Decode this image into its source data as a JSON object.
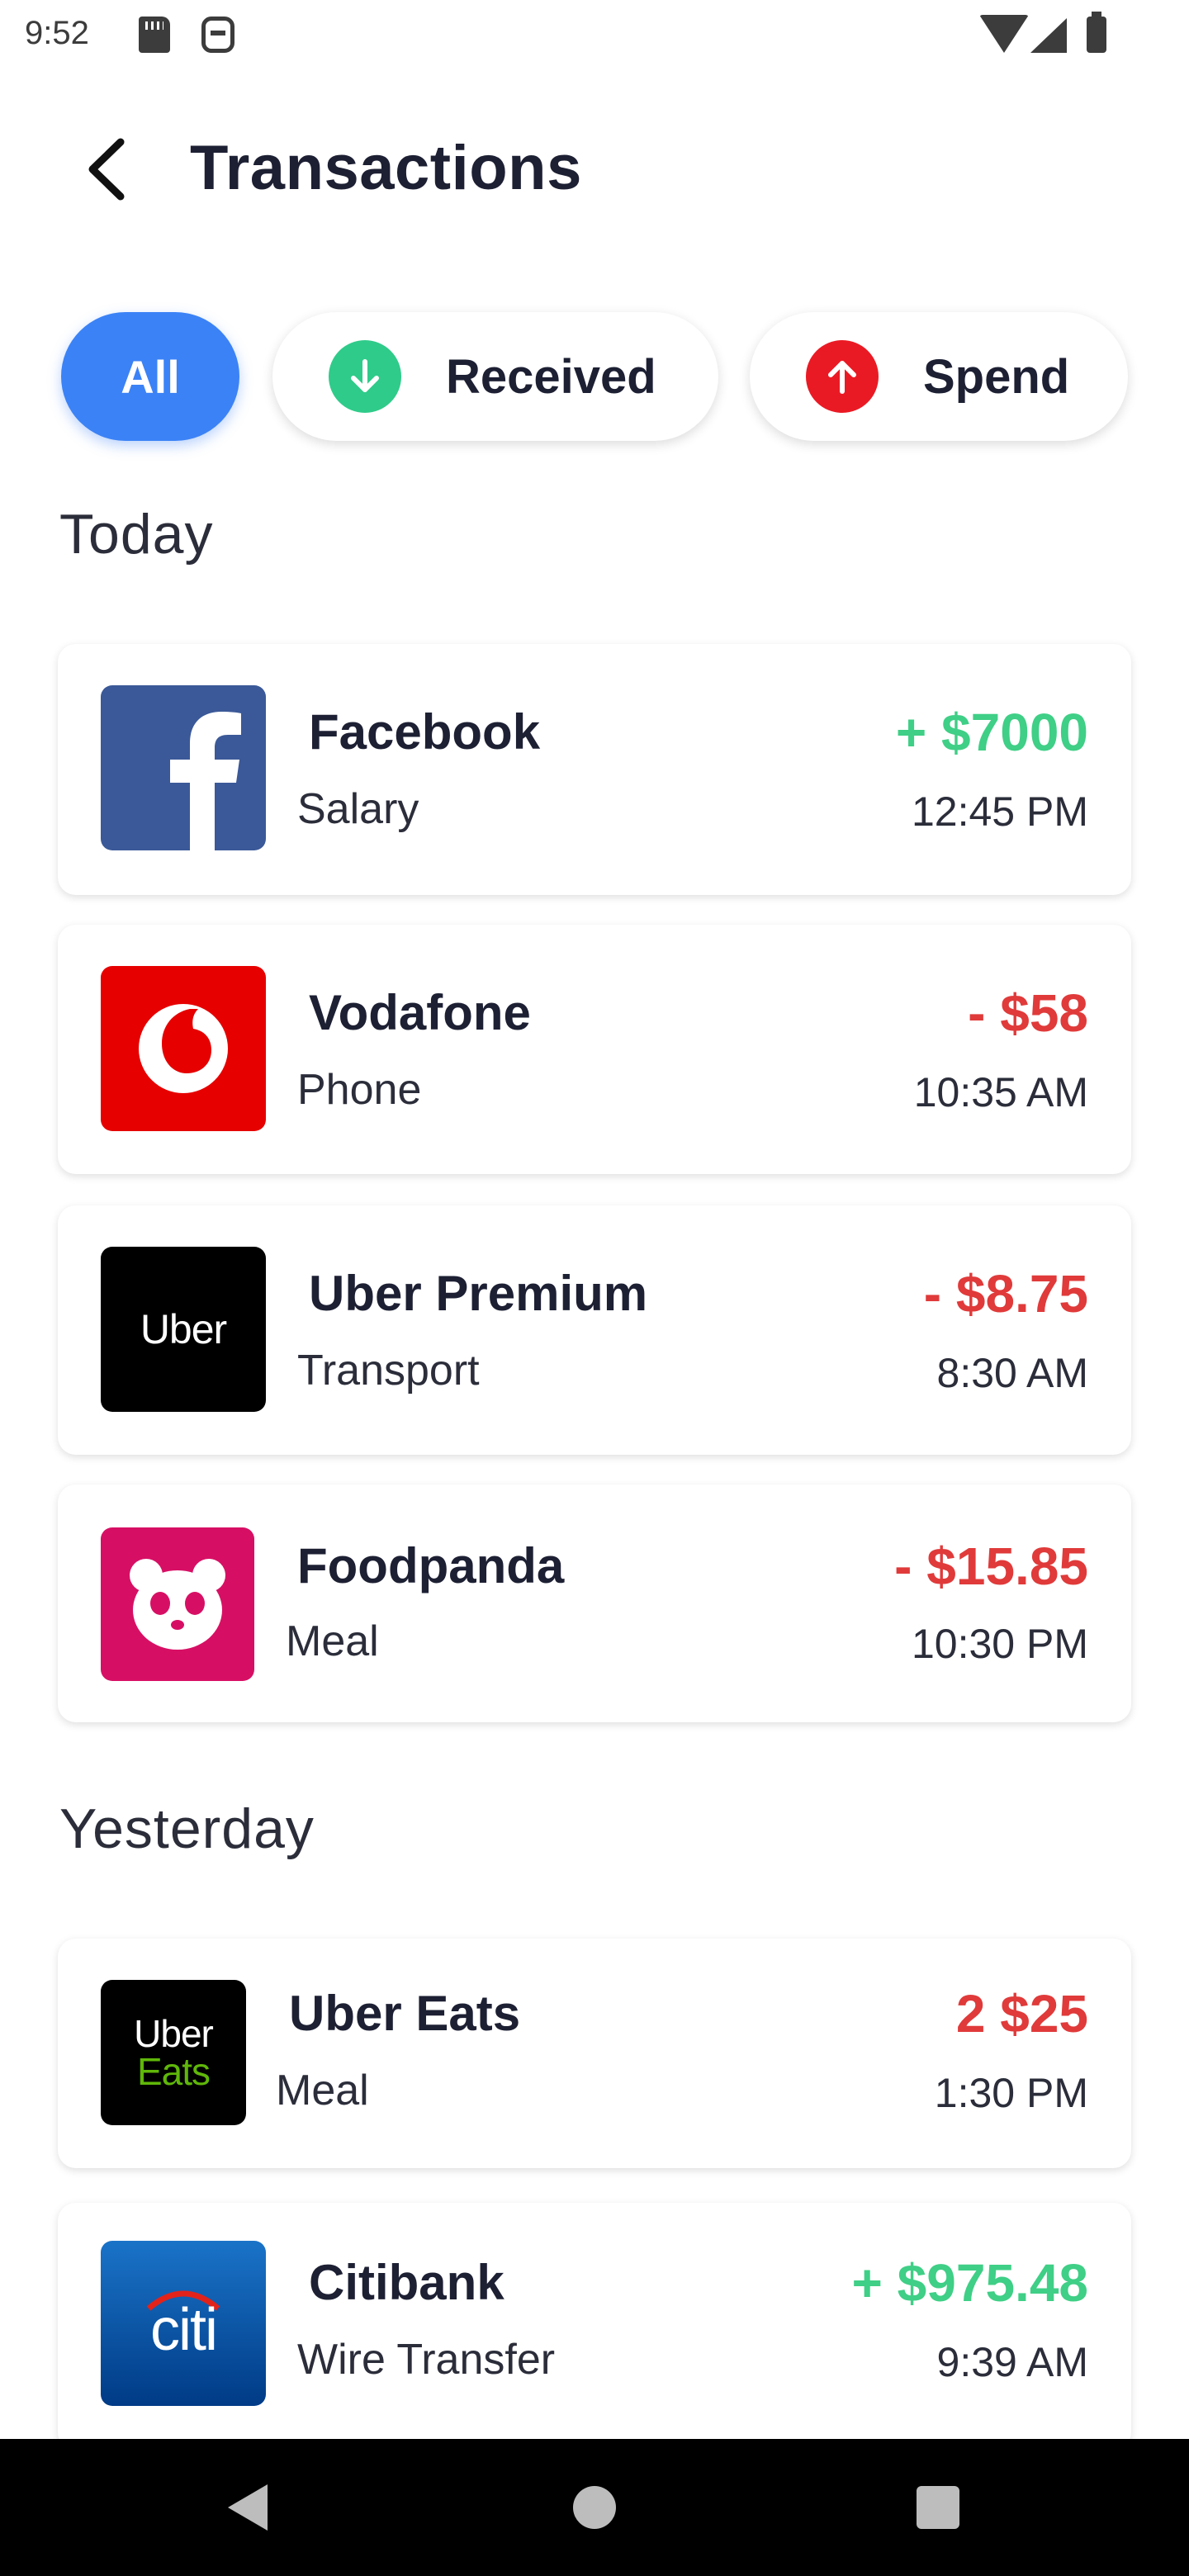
{
  "status_bar": {
    "time": "9:52",
    "icons": [
      "sd-card-icon",
      "vpn-icon",
      "wifi-icon",
      "signal-icon",
      "battery-icon"
    ]
  },
  "header": {
    "title": "Transactions",
    "back_icon": "chevron-left-icon"
  },
  "filters": {
    "active": "All",
    "items": [
      {
        "label": "All"
      },
      {
        "label": "Received",
        "icon": "arrow-down-icon",
        "color": "#2fcb8a"
      },
      {
        "label": "Spend",
        "icon": "arrow-up-icon",
        "color": "#ea1a24"
      }
    ]
  },
  "colors": {
    "accent": "#3b82f6",
    "positive": "#3fcf86",
    "negative": "#e03a3a"
  },
  "sections": [
    {
      "heading": "Today",
      "transactions": [
        {
          "name": "Facebook",
          "category": "Salary",
          "amount": "+ $7000",
          "time": "12:45 PM",
          "type": "positive",
          "logo": "facebook-logo"
        },
        {
          "name": "Vodafone",
          "category": "Phone",
          "amount": "- $58",
          "time": "10:35 AM",
          "type": "negative",
          "logo": "vodafone-logo"
        },
        {
          "name": "Uber Premium",
          "category": "Transport",
          "amount": "- $8.75",
          "time": "8:30 AM",
          "type": "negative",
          "logo": "uber-logo",
          "logo_text": "Uber"
        },
        {
          "name": "Foodpanda",
          "category": "Meal",
          "amount": "- $15.85",
          "time": "10:30 PM",
          "type": "negative",
          "logo": "foodpanda-logo"
        }
      ]
    },
    {
      "heading": "Yesterday",
      "transactions": [
        {
          "name": "Uber Eats",
          "category": "Meal",
          "amount": "2 $25",
          "time": "1:30 PM",
          "type": "negative",
          "logo": "uber-eats-logo",
          "logo_text_1": "Uber",
          "logo_text_2": "Eats"
        },
        {
          "name": "Citibank",
          "category": "Wire Transfer",
          "amount": "+ $975.48",
          "time": "9:39 AM",
          "type": "positive",
          "logo": "citibank-logo",
          "logo_text": "citi"
        }
      ]
    }
  ],
  "nav_bar": {
    "buttons": [
      "back-nav-icon",
      "home-nav-icon",
      "recents-nav-icon"
    ]
  }
}
